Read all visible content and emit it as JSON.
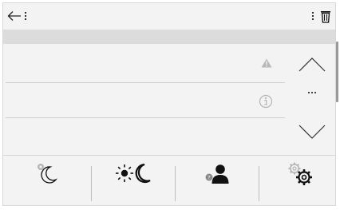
{
  "icons": {
    "back": "arrow-left-icon",
    "menu_left": "kebab-menu-icon",
    "menu_right": "kebab-menu-icon",
    "delete": "trash-icon",
    "row1_status": "warning-triangle-icon",
    "row2_status": "info-circle-icon",
    "scroll_up": "chevron-up-icon",
    "more": "more-dots-icon",
    "scroll_down": "chevron-down-icon"
  },
  "tabs": [
    {
      "icon": "night-mode-icon"
    },
    {
      "icon": "day-night-icon"
    },
    {
      "icon": "user-help-icon"
    },
    {
      "icon": "settings-gears-icon"
    }
  ],
  "colors": {
    "background": "#f3f3f3",
    "header_strip": "#dcdcdc",
    "icon_dark": "#111111",
    "icon_muted": "#b5b5b5"
  }
}
